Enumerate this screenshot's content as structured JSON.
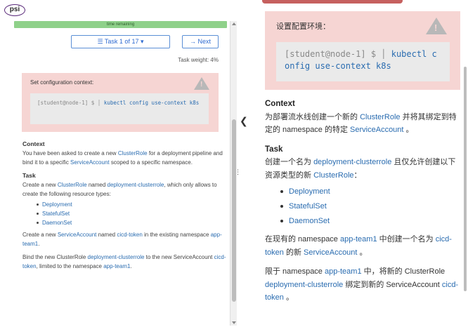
{
  "app": {
    "logo_text": "psi"
  },
  "header": {
    "progress_label": "time remaining",
    "task_selector": "☰ Task 1 of 17 ▾",
    "next_button": "→ Next",
    "task_weight": "Task weight: 4%"
  },
  "left": {
    "alert_title": "Set configuration context:",
    "code_prompt": "[student@node-1] $ │",
    "code_command": "kubectl config use-context k8s",
    "context_heading": "Context",
    "context_parts": [
      "You have been asked to create a new ",
      "ClusterRole",
      " for a deployment pipeline and bind it to a specific ",
      "ServiceAccount",
      " scoped to a specific namespace."
    ],
    "task_heading": "Task",
    "task_parts": [
      "Create a new ",
      "ClusterRole",
      " named ",
      "deployment-clusterrole",
      ", which only allows to create the following resource types:"
    ],
    "resources": [
      "Deployment",
      "StatefulSet",
      "DaemonSet"
    ],
    "p2_parts": [
      "Create a new ",
      "ServiceAccount",
      " named ",
      "cicd-token",
      " in the existing namespace ",
      "app-team1",
      "."
    ],
    "p3_parts": [
      "Bind the new ClusterRole ",
      "deployment-clusterrole",
      " to the new ServiceAccount ",
      "cicd-token",
      ", limited to the namespace ",
      "app-team1",
      "."
    ]
  },
  "right": {
    "alert_title": "设置配置环境：",
    "code_prompt": "[student@node-1] $ │",
    "code_line1": "kubectl c",
    "code_line2": "onfig use-context k8s",
    "context_heading": "Context",
    "context_parts": [
      "为部署流水线创建一个新的 ",
      "ClusterRole",
      " 并将其绑定到特定的 namespace 的特定 ",
      "ServiceAccount",
      " 。"
    ],
    "task_heading": "Task",
    "task_parts": [
      "创建一个名为 ",
      "deployment-clusterrole",
      " 且仅允许创建以下资源类型的新 ",
      "ClusterRole",
      "："
    ],
    "resources": [
      "Deployment",
      "StatefulSet",
      "DaemonSet"
    ],
    "p2_parts": [
      "在现有的 namespace ",
      "app-team1",
      " 中创建一个名为 ",
      "cicd-token",
      " 的新 ",
      "ServiceAccount",
      " 。"
    ],
    "p3_parts": [
      "限于 namespace ",
      "app-team1",
      " 中，将新的 ClusterRole ",
      "deployment-clusterrole",
      " 绑定到新的 ServiceAccount ",
      "cicd-token",
      " 。"
    ]
  },
  "divider": {
    "collapse_glyph": "❮",
    "grip_glyph": "⋮"
  },
  "colors": {
    "link": "#2a6cb0",
    "alert_bg": "#f6d5d3",
    "progress": "#8fd18a",
    "button_border": "#5b8fd6"
  }
}
